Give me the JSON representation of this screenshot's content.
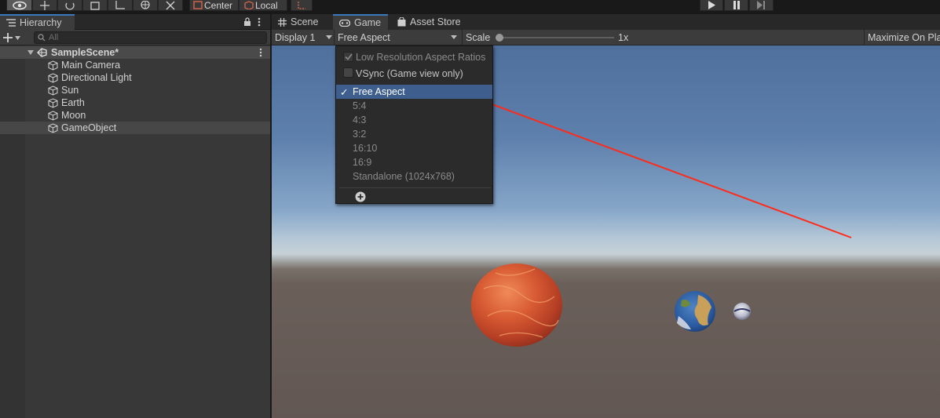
{
  "toolbar": {
    "center_label": "Center",
    "local_label": "Local"
  },
  "hierarchy": {
    "tab_label": "Hierarchy",
    "search_placeholder": "All",
    "scene_name": "SampleScene*",
    "items": [
      {
        "label": "Main Camera"
      },
      {
        "label": "Directional Light"
      },
      {
        "label": "Sun"
      },
      {
        "label": "Earth"
      },
      {
        "label": "Moon"
      },
      {
        "label": "GameObject"
      }
    ]
  },
  "game_tabs": [
    {
      "label": "Scene"
    },
    {
      "label": "Game"
    },
    {
      "label": "Asset Store"
    }
  ],
  "game_toolbar": {
    "display": "Display 1",
    "aspect": "Free Aspect",
    "scale_label": "Scale",
    "scale_value": "1x",
    "scale_fraction": 0.0,
    "maximize_label": "Maximize On Pla"
  },
  "aspect_menu": {
    "low_res": "Low Resolution Aspect Ratios",
    "vsync": "VSync (Game view only)",
    "checkmark": "✓",
    "items": [
      {
        "label": "Free Aspect",
        "selected": true
      },
      {
        "label": "5:4"
      },
      {
        "label": "4:3"
      },
      {
        "label": "3:2"
      },
      {
        "label": "16:10"
      },
      {
        "label": "16:9"
      },
      {
        "label": "Standalone (1024x768)"
      }
    ]
  },
  "colors": {
    "accent": "#3e5f8e",
    "annotation_arrow": "#ff2a1a"
  }
}
